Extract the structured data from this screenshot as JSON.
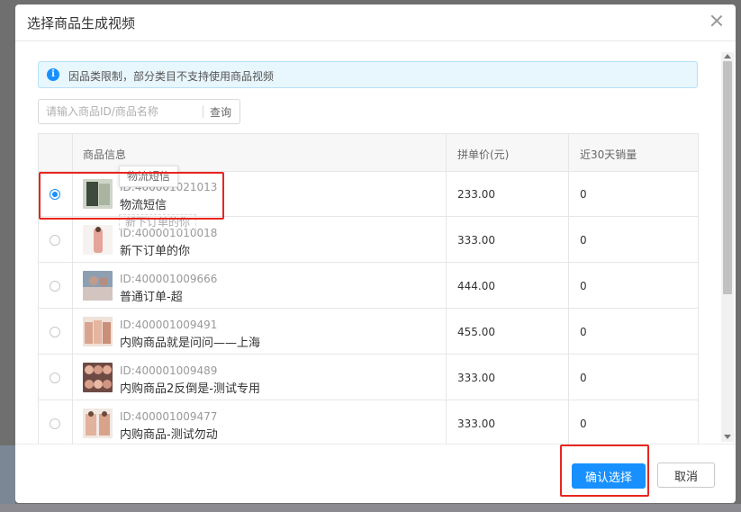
{
  "dialog": {
    "title": "选择商品生成视频",
    "notice": "因品类限制，部分类目不支持使用商品视频",
    "search": {
      "placeholder": "请输入商品ID/商品名称",
      "value": "",
      "button": "查询"
    },
    "columns": {
      "info": "商品信息",
      "price": "拼单价(元)",
      "sales": "近30天销量"
    },
    "products": [
      {
        "id": "ID:400001021013",
        "name": "物流短信",
        "price": "233.00",
        "sales": "0",
        "selected": true
      },
      {
        "id": "ID:400001010018",
        "name": "新下订单的你",
        "price": "333.00",
        "sales": "0",
        "selected": false
      },
      {
        "id": "ID:400001009666",
        "name": "普通订单-超",
        "price": "444.00",
        "sales": "0",
        "selected": false
      },
      {
        "id": "ID:400001009491",
        "name": "内购商品就是问问——上海",
        "price": "455.00",
        "sales": "0",
        "selected": false
      },
      {
        "id": "ID:400001009489",
        "name": "内购商品2反倒是-测试专用",
        "price": "333.00",
        "sales": "0",
        "selected": false
      },
      {
        "id": "ID:400001009477",
        "name": "内购商品-测试勿动",
        "price": "333.00",
        "sales": "0",
        "selected": false
      }
    ],
    "tooltip": "物流短信",
    "ghost_label": "新下订单的你",
    "footer": {
      "confirm": "确认选择",
      "cancel": "取消"
    }
  },
  "colors": {
    "primary": "#1890ff",
    "highlight": "#e8251f",
    "notice_bg": "#e8f6fd"
  }
}
